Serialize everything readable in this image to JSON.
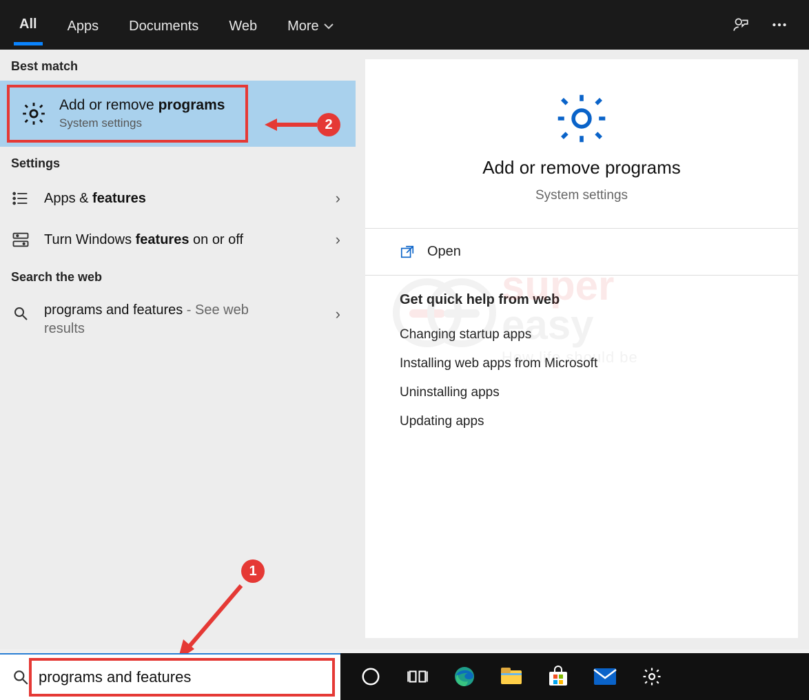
{
  "filters": {
    "all": "All",
    "apps": "Apps",
    "documents": "Documents",
    "web": "Web",
    "more": "More"
  },
  "sections": {
    "best_match": "Best match",
    "settings": "Settings",
    "search_web": "Search the web"
  },
  "best_match": {
    "title_prefix": "Add or remove ",
    "title_bold": "programs",
    "subtitle": "System settings"
  },
  "settings_rows": [
    {
      "prefix": "Apps & ",
      "bold": "features"
    },
    {
      "prefix": "Turn Windows ",
      "bold": "features",
      "suffix": " on or off"
    }
  ],
  "web_row": {
    "query": "programs and features",
    "hint": " - See web results"
  },
  "detail": {
    "title": "Add or remove programs",
    "subtitle": "System settings",
    "open": "Open"
  },
  "help": {
    "title": "Get quick help from web",
    "links": [
      "Changing startup apps",
      "Installing web apps from Microsoft",
      "Uninstalling apps",
      "Updating apps"
    ]
  },
  "watermark": {
    "line1": "super",
    "line2": "easy",
    "tagline": "How life should be"
  },
  "annotations": {
    "one": "1",
    "two": "2"
  },
  "search": {
    "value": "programs and features"
  }
}
